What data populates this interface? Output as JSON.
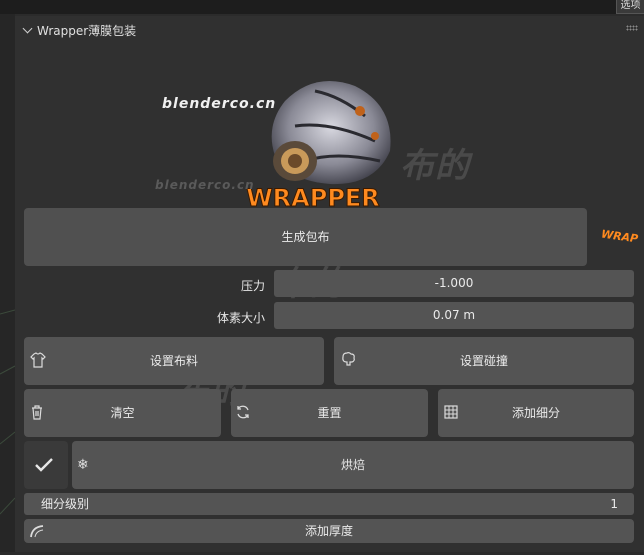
{
  "topbar": {
    "tag_label": "选项"
  },
  "panel": {
    "title": "Wrapper薄膜包装"
  },
  "logo": {
    "text": "WRAPPER",
    "badge": "WRAP"
  },
  "watermarks": {
    "site": "blenderco.cn",
    "brand": "布的"
  },
  "buttons": {
    "generate": "生成包布",
    "set_cloth": "设置布料",
    "set_collision": "设置碰撞",
    "clear": "清空",
    "reset": "重置",
    "add_subdiv": "添加细分",
    "bake": "烘焙",
    "add_thickness": "添加厚度"
  },
  "fields": {
    "pressure": {
      "label": "压力",
      "value": "-1.000"
    },
    "voxel_size": {
      "label": "体素大小",
      "value": "0.07 m"
    },
    "subdiv_level": {
      "label": "细分级别",
      "value": "1"
    }
  },
  "icons": {
    "panel_collapse": "chevron-down-icon",
    "set_cloth": "shirt-icon",
    "set_collision": "brain-icon",
    "clear": "trash-icon",
    "reset": "refresh-icon",
    "add_subdiv": "grid-icon",
    "bake_toggle": "checkmark-icon",
    "bake": "snowflake-icon",
    "add_thickness": "arc-icon"
  },
  "colors": {
    "panel_bg": "#303030",
    "button_bg": "#545454",
    "accent_orange": "#ff8a1f"
  }
}
